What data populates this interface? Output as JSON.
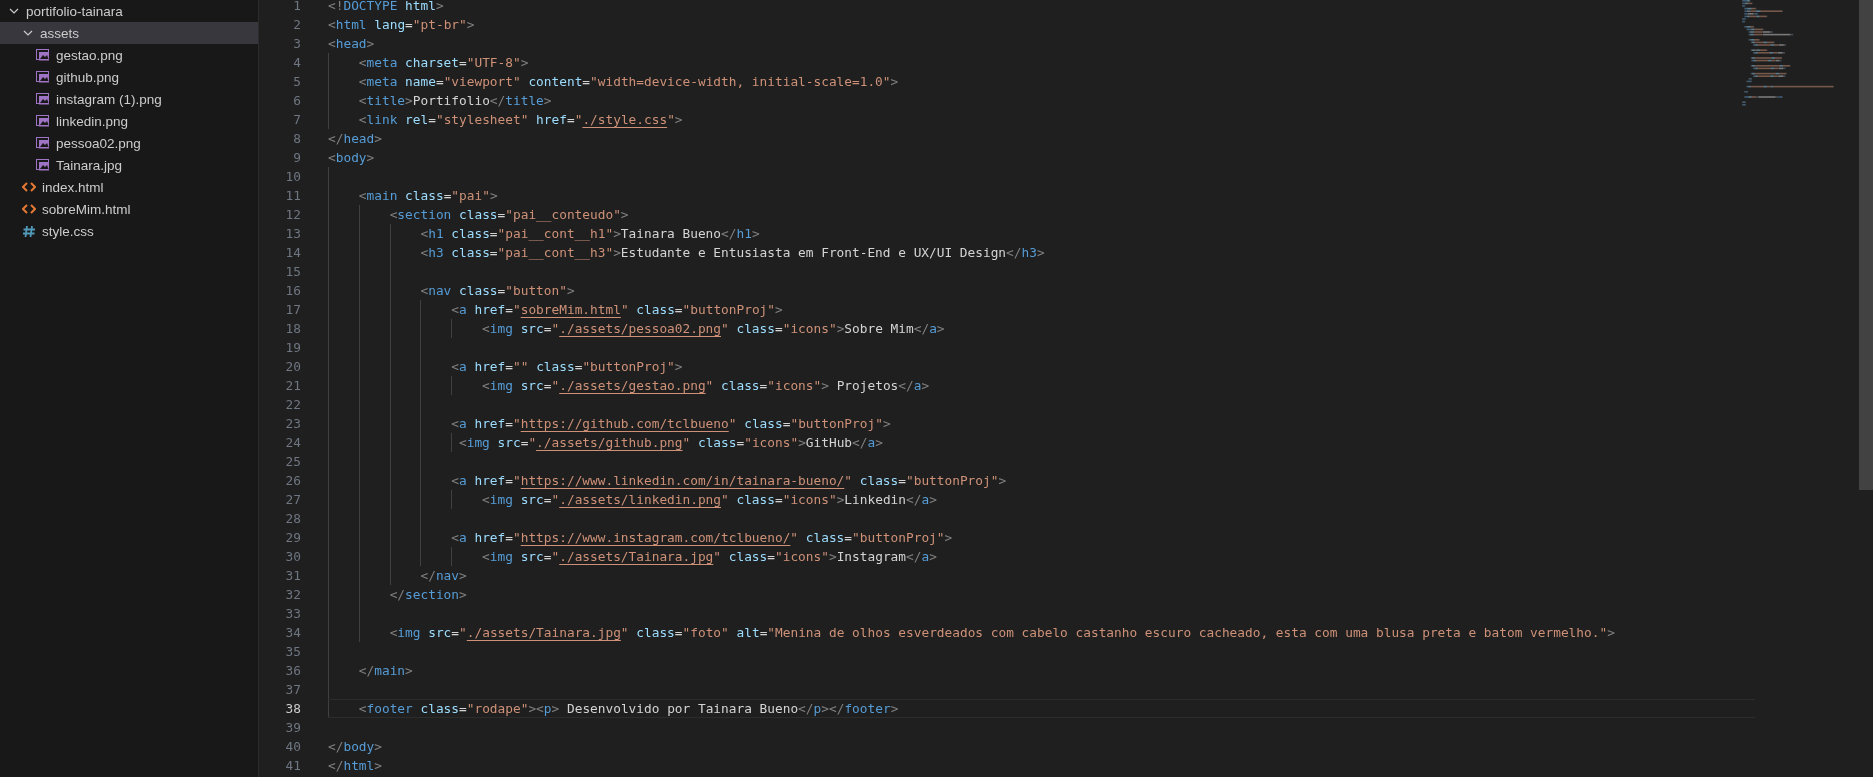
{
  "explorer": {
    "tree": [
      {
        "label": "portifolio-tainara",
        "kind": "folder",
        "expanded": true,
        "selected": false,
        "children": [
          {
            "label": "assets",
            "kind": "folder",
            "expanded": true,
            "selected": true,
            "children": [
              {
                "label": "gestao.png",
                "kind": "image",
                "selected": false
              },
              {
                "label": "github.png",
                "kind": "image",
                "selected": false
              },
              {
                "label": "instagram (1).png",
                "kind": "image",
                "selected": false
              },
              {
                "label": "linkedin.png",
                "kind": "image",
                "selected": false
              },
              {
                "label": "pessoa02.png",
                "kind": "image",
                "selected": false
              },
              {
                "label": "Tainara.jpg",
                "kind": "image",
                "selected": false
              }
            ]
          },
          {
            "label": "index.html",
            "kind": "html",
            "selected": false
          },
          {
            "label": "sobreMim.html",
            "kind": "html",
            "selected": false
          },
          {
            "label": "style.css",
            "kind": "css",
            "selected": false
          }
        ]
      }
    ]
  },
  "editor": {
    "lines": [
      {
        "num": "1",
        "current": false,
        "code": "<!DOCTYPE html>"
      },
      {
        "num": "2",
        "current": false,
        "code": "<html lang=\"pt-br\">"
      },
      {
        "num": "3",
        "current": false,
        "code": "<head>"
      },
      {
        "num": "4",
        "current": false,
        "code": "    <meta charset=\"UTF-8\">"
      },
      {
        "num": "5",
        "current": false,
        "code": "    <meta name=\"viewport\" content=\"width=device-width, initial-scale=1.0\">"
      },
      {
        "num": "6",
        "current": false,
        "code": "    <title>Portifolio</title>"
      },
      {
        "num": "7",
        "current": false,
        "code": "    <link rel=\"stylesheet\" href=\"./style.css\">"
      },
      {
        "num": "8",
        "current": false,
        "code": "</head>"
      },
      {
        "num": "9",
        "current": false,
        "code": "<body>"
      },
      {
        "num": "10",
        "current": false
      },
      {
        "num": "11",
        "current": false,
        "code": "    <main class=\"pai\">"
      },
      {
        "num": "12",
        "current": false,
        "code": "        <section class=\"pai__conteudo\">"
      },
      {
        "num": "13",
        "current": false,
        "code": "            <h1 class=\"pai__cont__h1\">Tainara Bueno</h1>"
      },
      {
        "num": "14",
        "current": false,
        "code": "            <h3 class=\"pai__cont__h3\">Estudante e Entusiasta em Front-End e UX/UI Design</h3>"
      },
      {
        "num": "15",
        "current": false
      },
      {
        "num": "16",
        "current": false,
        "code": "            <nav class=\"button\">"
      },
      {
        "num": "17",
        "current": false,
        "code": "                <a href=\"sobreMim.html\" class=\"buttonProj\">"
      },
      {
        "num": "18",
        "current": false,
        "code": "                    <img src=\"./assets/pessoa02.png\" class=\"icons\">Sobre Mim</a>"
      },
      {
        "num": "19",
        "current": false
      },
      {
        "num": "20",
        "current": false,
        "code": "                <a href=\"\" class=\"buttonProj\">"
      },
      {
        "num": "21",
        "current": false,
        "code": "                    <img src=\"./assets/gestao.png\" class=\"icons\"> Projetos</a>"
      },
      {
        "num": "22",
        "current": false
      },
      {
        "num": "23",
        "current": false,
        "code": "                <a href=\"https://github.com/tclbueno\" class=\"buttonProj\">"
      },
      {
        "num": "24",
        "current": false,
        "code": "                 <img src=\"./assets/github.png\" class=\"icons\">GitHub</a>"
      },
      {
        "num": "25",
        "current": false
      },
      {
        "num": "26",
        "current": false,
        "code": "                <a href=\"https://www.linkedin.com/in/tainara-bueno/\" class=\"buttonProj\">"
      },
      {
        "num": "27",
        "current": false,
        "code": "                    <img src=\"./assets/linkedin.png\" class=\"icons\">Linkedin</a>"
      },
      {
        "num": "28",
        "current": false
      },
      {
        "num": "29",
        "current": false,
        "code": "                <a href=\"https://www.instagram.com/tclbueno/\" class=\"buttonProj\">"
      },
      {
        "num": "30",
        "current": false,
        "code": "                    <img src=\"./assets/Tainara.jpg\" class=\"icons\">Instagram</a>"
      },
      {
        "num": "31",
        "current": false,
        "code": "            </nav>"
      },
      {
        "num": "32",
        "current": false,
        "code": "        </section>"
      },
      {
        "num": "33",
        "current": false
      },
      {
        "num": "34",
        "current": false,
        "code": "        <img src=\"./assets/Tainara.jpg\" class=\"foto\" alt=\"Menina de olhos esverdeados com cabelo castanho escuro cacheado, esta com uma blusa preta e batom vermelho.\">"
      },
      {
        "num": "35",
        "current": false
      },
      {
        "num": "36",
        "current": false,
        "code": "    </main>"
      },
      {
        "num": "37",
        "current": false
      },
      {
        "num": "38",
        "current": true,
        "code": "    <footer class=\"rodape\"><p> Desenvolvido por Tainara Bueno</p></footer>"
      },
      {
        "num": "39",
        "current": false
      },
      {
        "num": "40",
        "current": false,
        "code": "</body>"
      },
      {
        "num": "41",
        "current": false,
        "code": "</html>"
      }
    ]
  }
}
